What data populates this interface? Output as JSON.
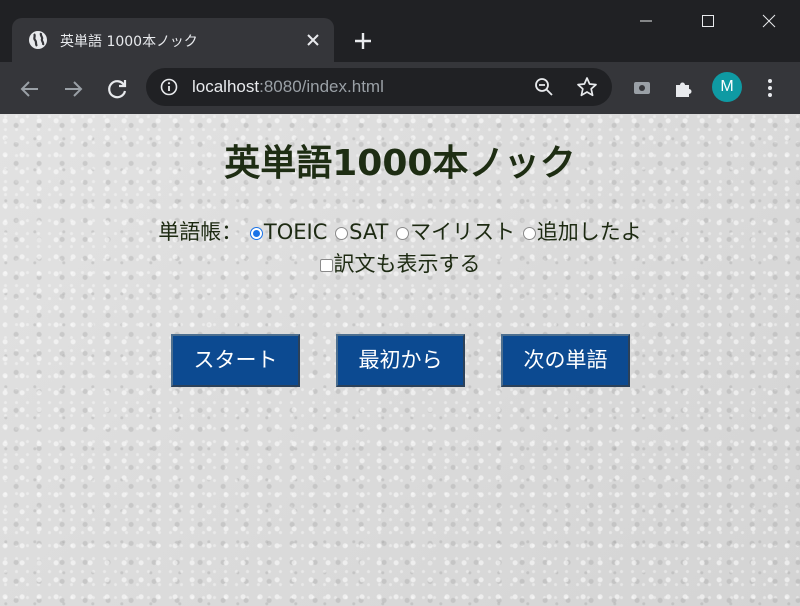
{
  "browser": {
    "tab_title": "英単語 1000本ノック",
    "url_host": "localhost",
    "url_rest": ":8080/index.html",
    "profile_initial": "M",
    "colors": {
      "frame": "#202124",
      "toolbar": "#35363a",
      "avatar": "#0f9aa3"
    },
    "icons": [
      "globe-icon",
      "close-icon",
      "plus-icon",
      "minimize-icon",
      "maximize-icon",
      "window-close-icon",
      "back-arrow-icon",
      "forward-arrow-icon",
      "reload-icon",
      "info-icon",
      "zoom-out-icon",
      "star-icon",
      "media-icon",
      "extensions-icon",
      "menu-icon"
    ]
  },
  "page": {
    "title": "英単語1000本ノック",
    "wordbook_label": "単語帳：",
    "wordbooks": [
      {
        "label": "TOEIC",
        "checked": true
      },
      {
        "label": "SAT",
        "checked": false
      },
      {
        "label": "マイリスト",
        "checked": false
      },
      {
        "label": "追加したよ",
        "checked": false
      }
    ],
    "show_translation": {
      "label": "訳文も表示する",
      "checked": false
    },
    "buttons": {
      "start": "スタート",
      "reset": "最初から",
      "next": "次の単語"
    },
    "colors": {
      "title": "#1e2d13",
      "button": "#0c4a91",
      "radio_checked": "#1a73e8"
    }
  }
}
